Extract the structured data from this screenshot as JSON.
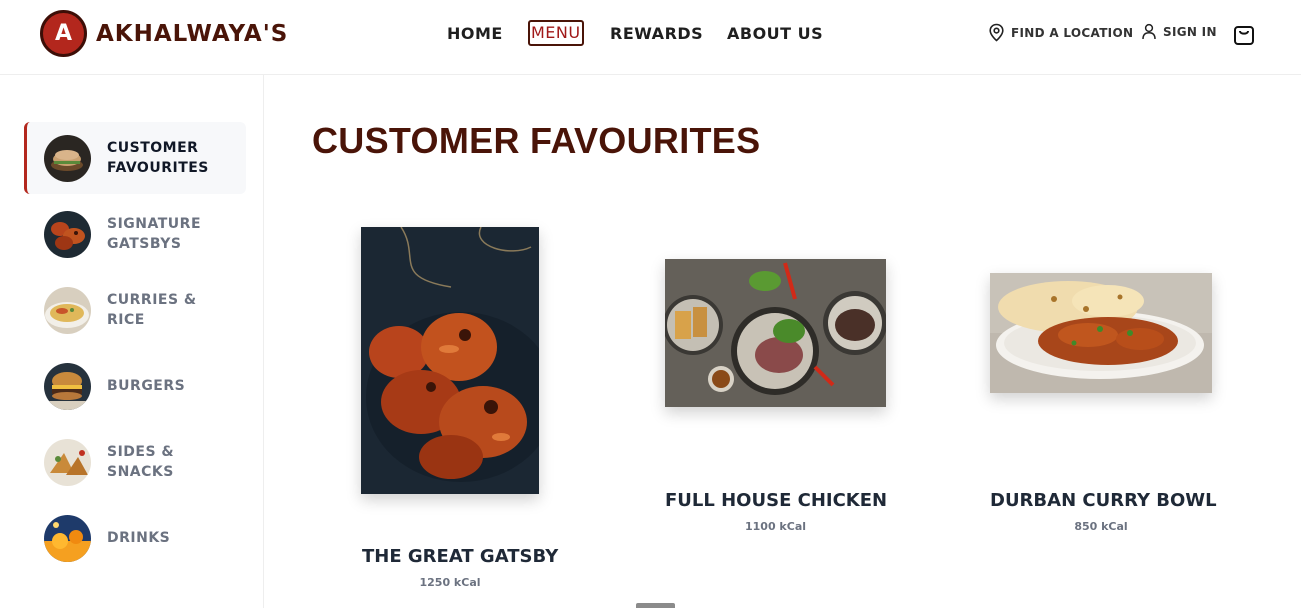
{
  "brand": {
    "logo_letter": "A",
    "name": "AKHALWAYA'S"
  },
  "nav": {
    "home": "HOME",
    "menu": "MENU",
    "rewards": "REWARDS",
    "about": "ABOUT US"
  },
  "utility": {
    "find_location": "FIND A LOCATION",
    "sign_in": "SIGN IN"
  },
  "sidebar": {
    "items": [
      {
        "label": "CUSTOMER FAVOURITES",
        "active": true
      },
      {
        "label": "SIGNATURE GATSBYS",
        "active": false
      },
      {
        "label": "CURRIES & RICE",
        "active": false
      },
      {
        "label": "BURGERS",
        "active": false
      },
      {
        "label": "SIDES & SNACKS",
        "active": false
      },
      {
        "label": "DRINKS",
        "active": false
      }
    ]
  },
  "main": {
    "title": "CUSTOMER FAVOURITES",
    "products": [
      {
        "name": "THE GREAT GATSBY",
        "kcal": "1250 kCal"
      },
      {
        "name": "FULL HOUSE CHICKEN",
        "kcal": "1100 kCal"
      },
      {
        "name": "DURBAN CURRY BOWL",
        "kcal": "850 kCal"
      }
    ]
  },
  "colors": {
    "brand_dark": "#4a1408",
    "brand_red": "#b3271d",
    "active_bg": "#f7f8fa"
  }
}
